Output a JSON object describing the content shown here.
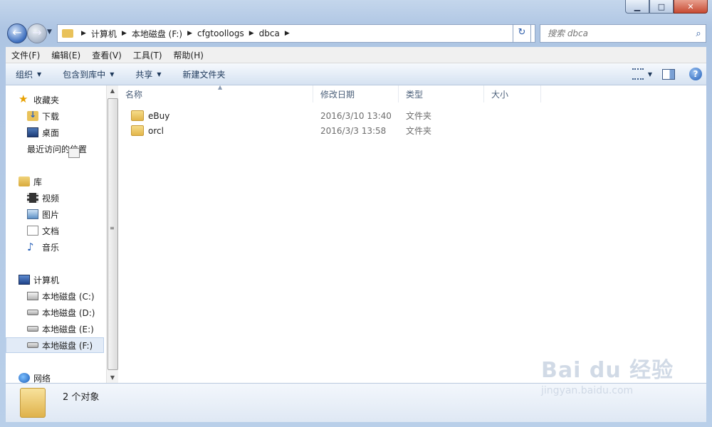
{
  "window": {
    "minimize_icon": "minimize-icon",
    "maximize_icon": "maximize-icon",
    "close_icon": "close-icon"
  },
  "nav": {
    "back_icon": "back-arrow-icon",
    "forward_icon": "forward-arrow-icon",
    "breadcrumb": [
      "计算机",
      "本地磁盘 (F:)",
      "cfgtoollogs",
      "dbca"
    ],
    "search_placeholder": "搜索 dbca"
  },
  "menu": [
    "文件(F)",
    "编辑(E)",
    "查看(V)",
    "工具(T)",
    "帮助(H)"
  ],
  "toolbar": {
    "organize": "组织",
    "include_library": "包含到库中",
    "share": "共享",
    "new_folder": "新建文件夹"
  },
  "sidebar": {
    "favorites": "收藏夹",
    "downloads": "下载",
    "desktop": "桌面",
    "recent": "最近访问的位置",
    "libraries": "库",
    "videos": "视频",
    "pictures": "图片",
    "documents": "文档",
    "music": "音乐",
    "computer": "计算机",
    "drive_c": "本地磁盘 (C:)",
    "drive_d": "本地磁盘 (D:)",
    "drive_e": "本地磁盘 (E:)",
    "drive_f": "本地磁盘 (F:)",
    "network": "网络"
  },
  "columns": {
    "name": "名称",
    "modified": "修改日期",
    "type": "类型",
    "size": "大小"
  },
  "files": [
    {
      "name": "eBuy",
      "modified": "2016/3/10 13:40",
      "type": "文件夹"
    },
    {
      "name": "orcl",
      "modified": "2016/3/3 13:58",
      "type": "文件夹"
    }
  ],
  "status": {
    "count": "2 个对象"
  },
  "watermark": {
    "line1": "Bai du 经验",
    "line2": "jingyan.baidu.com"
  }
}
